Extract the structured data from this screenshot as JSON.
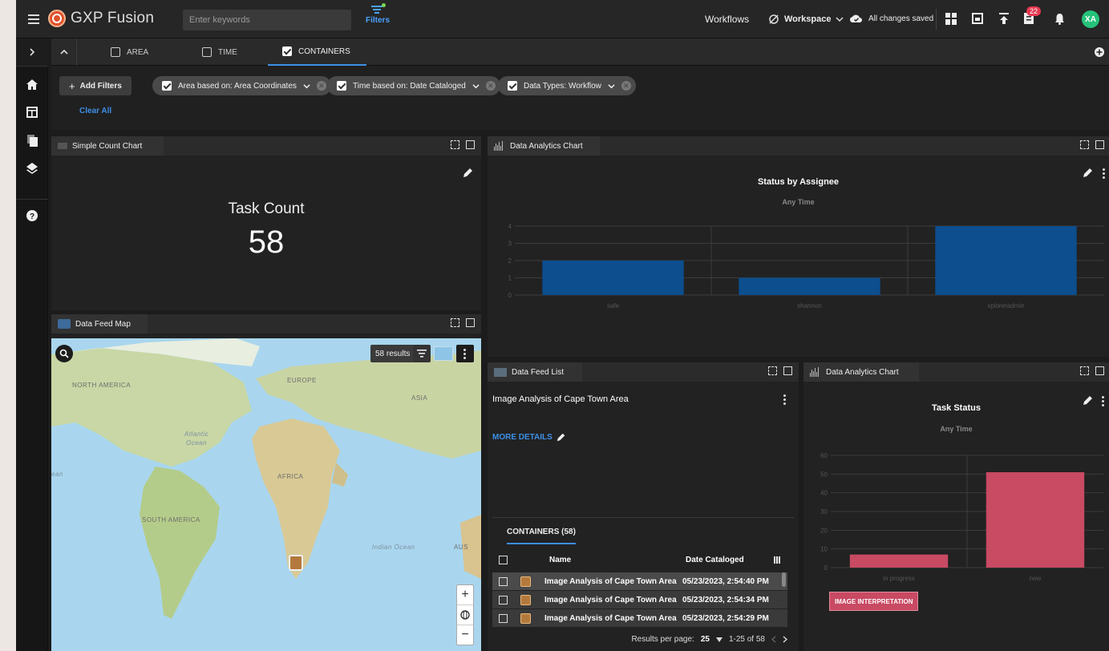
{
  "app": {
    "name": "GXP Fusion"
  },
  "search": {
    "placeholder": "Enter keywords"
  },
  "topbar": {
    "filters_label": "Filters",
    "workflows_label": "Workflows",
    "workspace_label": "Workspace",
    "saved_label": "All changes saved",
    "notification_count": "22",
    "avatar_initials": "XA"
  },
  "filter_tabs": [
    {
      "label": "AREA",
      "checked": false
    },
    {
      "label": "TIME",
      "checked": false
    },
    {
      "label": "CONTAINERS",
      "checked": true
    }
  ],
  "filter_chips": {
    "add_label": "Add Filters",
    "clear_label": "Clear All",
    "chips": [
      "Area based on: Area Coordinates",
      "Time based on: Date Cataloged",
      "Data Types: Workflow"
    ]
  },
  "count_panel": {
    "tab": "Simple Count Chart",
    "label": "Task Count",
    "value": "58"
  },
  "analytics1": {
    "tab": "Data Analytics Chart",
    "title": "Status by Assignee",
    "subtitle": "Any Time",
    "chart_data": {
      "type": "bar",
      "title": "Status by Assignee",
      "subtitle": "Any Time",
      "categories": [
        "safe",
        "shannon",
        "xploreradmin"
      ],
      "values": [
        2,
        1,
        4
      ],
      "ylim": [
        0,
        4
      ],
      "yticks": [
        0,
        1,
        2,
        3,
        4
      ],
      "color": "#0c4e8e",
      "grid": true
    }
  },
  "map_panel": {
    "tab": "Data Feed Map",
    "results_label": "58 results",
    "labels": [
      "NORTH AMERICA",
      "EUROPE",
      "ASIA",
      "Atlantic",
      "Ocean",
      "AFRICA",
      "SOUTH AMERICA",
      "Indian Ocean",
      "AUS",
      "ean"
    ]
  },
  "feed_list": {
    "tab": "Data Feed List",
    "item_title": "Image Analysis of Cape Town Area",
    "more_details": "MORE DETAILS",
    "containers_tab": "CONTAINERS (58)",
    "col_name": "Name",
    "col_date": "Date Cataloged",
    "rows": [
      {
        "name": "Image Analysis of Cape Town Area",
        "date": "05/23/2023, 2:54:40 PM"
      },
      {
        "name": "Image Analysis of Cape Town Area",
        "date": "05/23/2023, 2:54:34 PM"
      },
      {
        "name": "Image Analysis of Cape Town Area",
        "date": "05/23/2023, 2:54:29 PM"
      }
    ],
    "per_page_label": "Results per page:",
    "per_page": "25",
    "range": "1-25 of 58"
  },
  "analytics2": {
    "tab": "Data Analytics Chart",
    "title": "Task Status",
    "subtitle": "Any Time",
    "chart_data": {
      "type": "bar",
      "title": "Task Status",
      "subtitle": "Any Time",
      "categories": [
        "in progress",
        "new"
      ],
      "values": [
        7,
        51
      ],
      "ylim": [
        0,
        60
      ],
      "yticks": [
        0,
        10,
        20,
        30,
        40,
        50,
        60
      ],
      "color": "#c84a63",
      "grid": true
    },
    "legend_label": "IMAGE INTERPRETATION"
  }
}
